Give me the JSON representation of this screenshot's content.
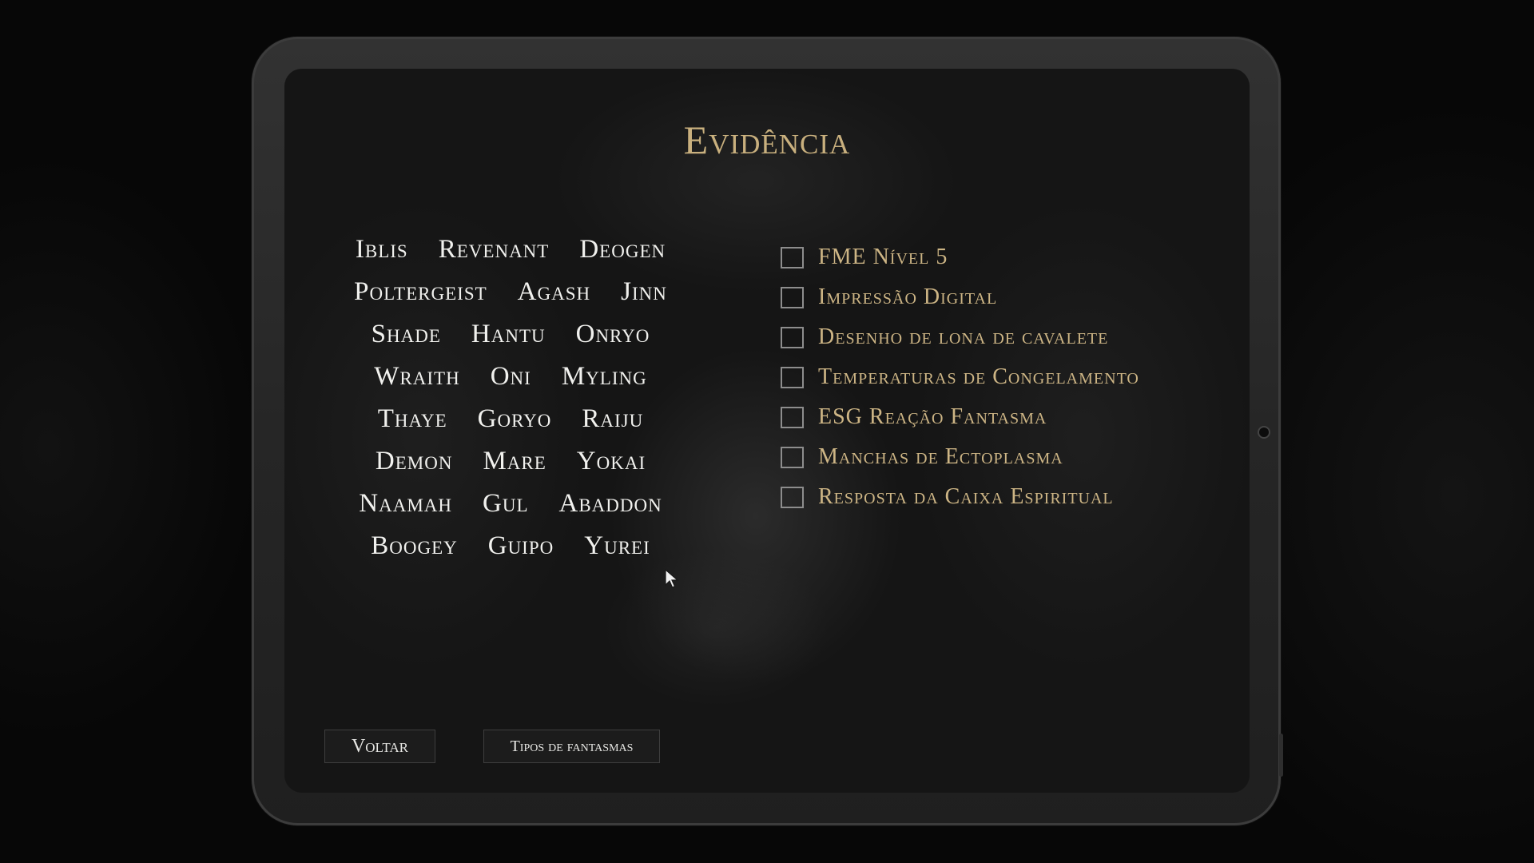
{
  "journal": {
    "title": "Evidência",
    "ghost_rows": [
      [
        "Iblis",
        "Revenant",
        "Deogen"
      ],
      [
        "Poltergeist",
        "Agash",
        "Jinn"
      ],
      [
        "Shade",
        "Hantu",
        "Onryo"
      ],
      [
        "Wraith",
        "Oni",
        "Myling"
      ],
      [
        "Thaye",
        "Goryo",
        "Raiju"
      ],
      [
        "Demon",
        "Mare",
        "Yokai"
      ],
      [
        "Naamah",
        "Gul",
        "Abaddon"
      ],
      [
        "Boogey",
        "Guipo",
        "Yurei"
      ]
    ],
    "evidence": [
      {
        "label": "FME Nível 5",
        "checked": false
      },
      {
        "label": "Impressão Digital",
        "checked": false
      },
      {
        "label": "Desenho de lona de cavalete",
        "checked": false
      },
      {
        "label": "Temperaturas de Congelamento",
        "checked": false
      },
      {
        "label": "ESG Reação Fantasma",
        "checked": false
      },
      {
        "label": "Manchas de Ectoplasma",
        "checked": false
      },
      {
        "label": "Resposta da Caixa Espiritual",
        "checked": false
      }
    ],
    "buttons": {
      "back": "Voltar",
      "ghost_types": "Tipos de fantasmas"
    }
  },
  "colors": {
    "title": "#c9b07e",
    "ghost_text": "#f1f1ee",
    "evidence_text": "#cdb585",
    "checkbox_border": "#8d8d8d"
  },
  "icons": {
    "cursor": "mouse-pointer-icon"
  }
}
